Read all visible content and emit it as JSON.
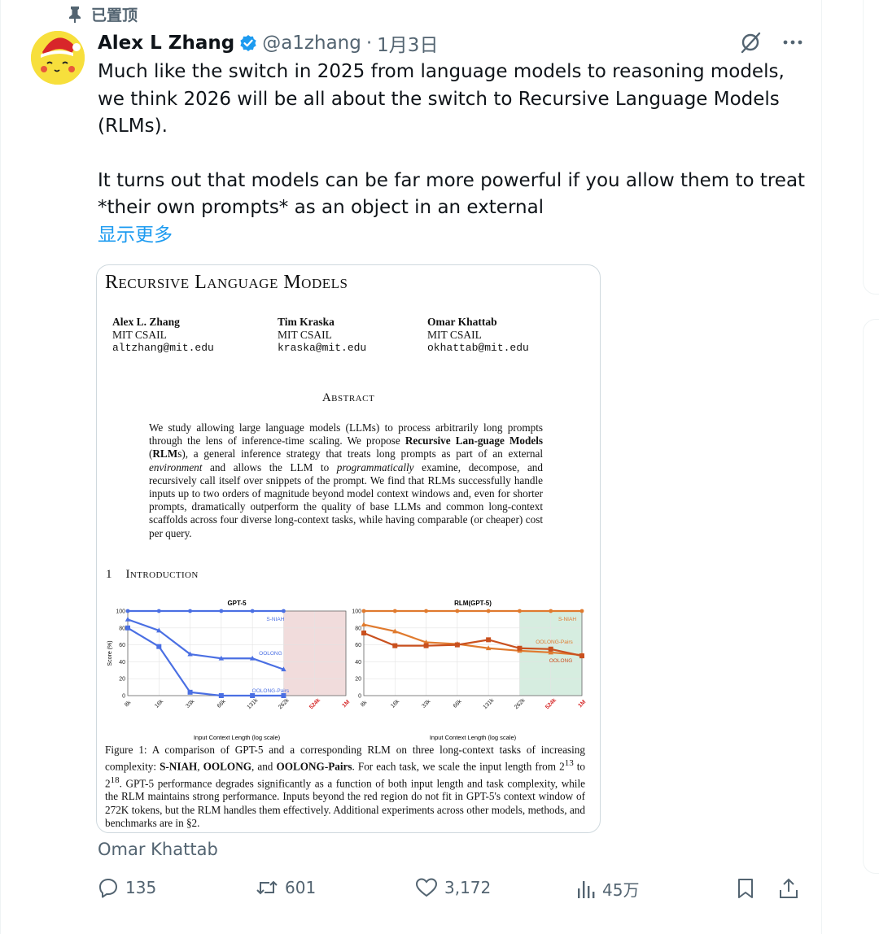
{
  "pinned_label": "已置顶",
  "tweet": {
    "display_name": "Alex L Zhang",
    "handle": "@a1zhang",
    "dot": "·",
    "date": "1月3日",
    "paragraph1": "Much like the switch in 2025 from language models to reasoning models, we think 2026 will be all about the switch to Recursive Language Models (RLMs).",
    "paragraph2": "It turns out that models can be far more powerful if you allow them to treat *their own prompts* as an object in an external",
    "show_more": "显示更多",
    "attribution": "Omar Khattab"
  },
  "paper": {
    "title": "Recursive Language Models",
    "authors": [
      {
        "name": "Alex L. Zhang",
        "affiliation": "MIT CSAIL",
        "email": "altzhang@mit.edu"
      },
      {
        "name": "Tim Kraska",
        "affiliation": "MIT CSAIL",
        "email": "kraska@mit.edu"
      },
      {
        "name": "Omar Khattab",
        "affiliation": "MIT CSAIL",
        "email": "okhattab@mit.edu"
      }
    ],
    "abstract_heading": "Abstract",
    "abstract_a": "We study allowing large language models (LLMs) to process arbitrarily long prompts through the lens of inference-time scaling. We propose ",
    "abstract_b1": "Recursive Lan-guage Models",
    "abstract_c": " (",
    "abstract_b2": "RLM",
    "abstract_d": "s), a general inference strategy that treats long prompts as part of an external ",
    "abstract_i1": "environment",
    "abstract_e": " and allows the LLM to ",
    "abstract_i2": "programmatically",
    "abstract_f": " examine, decompose, and recursively call itself over snippets of the prompt. We find that RLMs successfully handle inputs up to two orders of magnitude beyond model context windows and, even for shorter prompts, dramatically outperform the quality of base LLMs and common long-context scaffolds across four diverse long-context tasks, while having comparable (or cheaper) cost per query.",
    "intro_heading": "1    Introduction",
    "caption_a": "Figure 1: A comparison of GPT-5 and a corresponding RLM on three long-context tasks of increasing complexity: ",
    "caption_b1": "S-NIAH",
    "caption_sep1": ", ",
    "caption_b2": "OOLONG",
    "caption_sep2": ", and ",
    "caption_b3": "OOLONG-Pairs",
    "caption_c": ". For each task, we scale the input length from 2",
    "caption_sup1": "13",
    "caption_d": " to 2",
    "caption_sup2": "18",
    "caption_e": ". GPT-5 performance degrades significantly as a function of both input length and task complexity, while the RLM maintains strong performance. Inputs beyond the red region do not fit in GPT-5's context window of 272K tokens, but the RLM handles them effectively. Additional experiments across other models, methods, and benchmarks are in §2."
  },
  "chart_data": [
    {
      "type": "line",
      "title": "GPT-5",
      "xlabel": "Input Context Length (log scale)",
      "ylabel": "Score (%)",
      "x": [
        "8k",
        "16k",
        "33k",
        "66k",
        "131k",
        "262k",
        "524k",
        "1M"
      ],
      "x_red": [
        "524k",
        "1M"
      ],
      "yticks": [
        0,
        20,
        40,
        60,
        80,
        100
      ],
      "ylim": [
        0,
        100
      ],
      "shaded_from": "262k",
      "shade_color": "#f1dcdc",
      "series": [
        {
          "name": "S-NIAH",
          "color": "#4a6fe3",
          "marker": "circle",
          "values": [
            100,
            100,
            100,
            100,
            100,
            100,
            null,
            null
          ]
        },
        {
          "name": "OOLONG",
          "color": "#4a6fe3",
          "marker": "triangle",
          "values": [
            90,
            77,
            49,
            44,
            44,
            31,
            null,
            null
          ]
        },
        {
          "name": "OOLONG-Pairs",
          "color": "#4a6fe3",
          "marker": "square",
          "values": [
            80,
            58,
            4,
            0,
            0,
            0,
            null,
            null
          ]
        }
      ]
    },
    {
      "type": "line",
      "title": "RLM(GPT-5)",
      "xlabel": "Input Context Length (log scale)",
      "ylabel": "",
      "x": [
        "8k",
        "16k",
        "33k",
        "66k",
        "131k",
        "262k",
        "524k",
        "1M"
      ],
      "x_red": [
        "524k",
        "1M"
      ],
      "yticks": [
        0,
        20,
        40,
        60,
        80,
        100
      ],
      "ylim": [
        0,
        100
      ],
      "shaded_from": "262k",
      "shade_color": "#d6ede0",
      "series": [
        {
          "name": "S-NIAH",
          "color": "#e07a2e",
          "marker": "circle",
          "values": [
            100,
            100,
            100,
            100,
            100,
            100,
            100,
            100
          ]
        },
        {
          "name": "OOLONG-Pairs",
          "color": "#e07a2e",
          "marker": "triangle",
          "values": [
            84,
            76,
            63,
            61,
            56,
            53,
            51,
            48
          ]
        },
        {
          "name": "OOLONG",
          "color": "#c9501e",
          "marker": "square",
          "values": [
            74,
            59,
            59,
            60,
            66,
            56,
            55,
            47
          ]
        }
      ]
    }
  ],
  "actions": {
    "reply_count": "135",
    "repost_count": "601",
    "like_count": "3,172",
    "view_count": "45万"
  },
  "colors": {
    "accent": "#1d9bf0",
    "verified": "#1d9bf0",
    "muted": "#536471"
  }
}
